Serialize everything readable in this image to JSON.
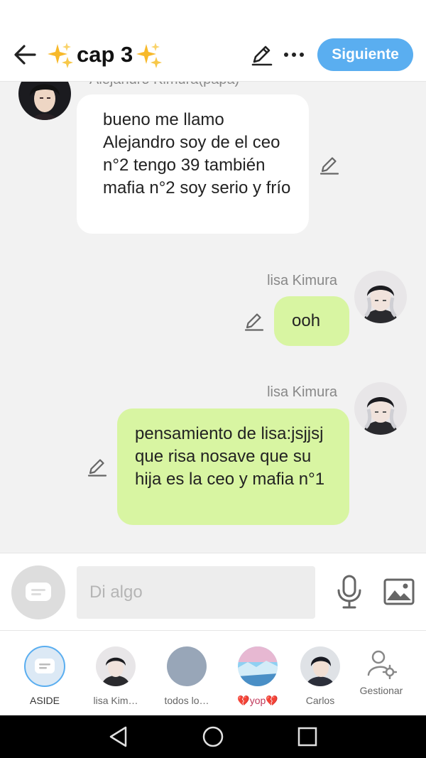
{
  "header": {
    "title": "cap 3",
    "next_label": "Siguiente",
    "accent": "#5aaef0"
  },
  "messages": [
    {
      "sender": "Alejandro Kimura(papa)",
      "text": "bueno me llamo Alejandro soy de el ceo n°2 tengo 39 también mafia n°2 soy serio y frío",
      "direction": "incoming"
    },
    {
      "sender": "lisa Kimura",
      "text": "ooh",
      "direction": "outgoing"
    },
    {
      "sender": "lisa Kimura",
      "text": "pensamiento de lisa:jsjjsj que risa nosave que su hija es la ceo y mafia n°1",
      "direction": "outgoing"
    }
  ],
  "composer": {
    "placeholder": "Di algo"
  },
  "tabs": [
    {
      "label": "ASIDE",
      "icon": "chat-bubble-icon"
    },
    {
      "label": "lisa Kim…",
      "icon": "avatar"
    },
    {
      "label": "todos lo…",
      "icon": "avatar"
    },
    {
      "label": "💔yop💔",
      "icon": "avatar"
    },
    {
      "label": "Carlos",
      "icon": "avatar"
    },
    {
      "label": "Gestionar",
      "icon": "manage-icon"
    }
  ],
  "colors": {
    "outgoing_bubble": "#d8f5a2",
    "incoming_bubble": "#ffffff",
    "background": "#f2f2f2"
  }
}
